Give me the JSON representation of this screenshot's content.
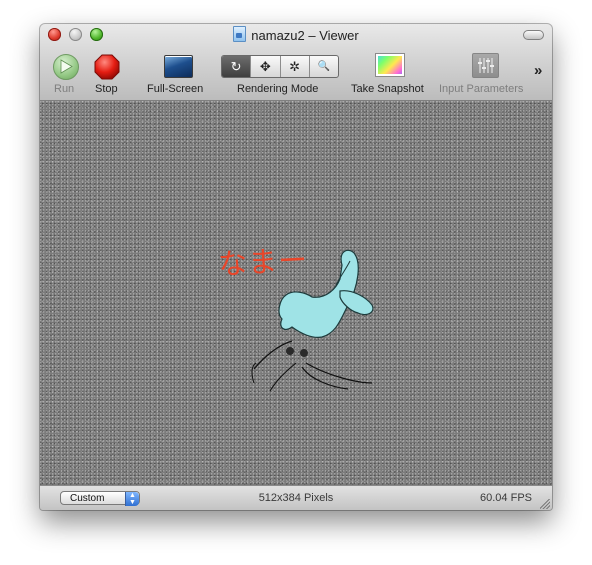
{
  "window": {
    "title": "namazu2 – Viewer"
  },
  "toolbar": {
    "run_label": "Run",
    "stop_label": "Stop",
    "fullscreen_label": "Full-Screen",
    "rendering_mode_label": "Rendering Mode",
    "rendering_modes": [
      "↻",
      "✥",
      "✲",
      "🔍"
    ],
    "snapshot_label": "Take Snapshot",
    "input_params_label": "Input Parameters",
    "overflow_icon": "»"
  },
  "viewport": {
    "overlay_text": "なまー",
    "overlay_color": "#e8462a",
    "fish_color": "#9fe3e6"
  },
  "status": {
    "size_preset": "Custom",
    "resolution": "512x384 Pixels",
    "fps": "60.04 FPS"
  }
}
